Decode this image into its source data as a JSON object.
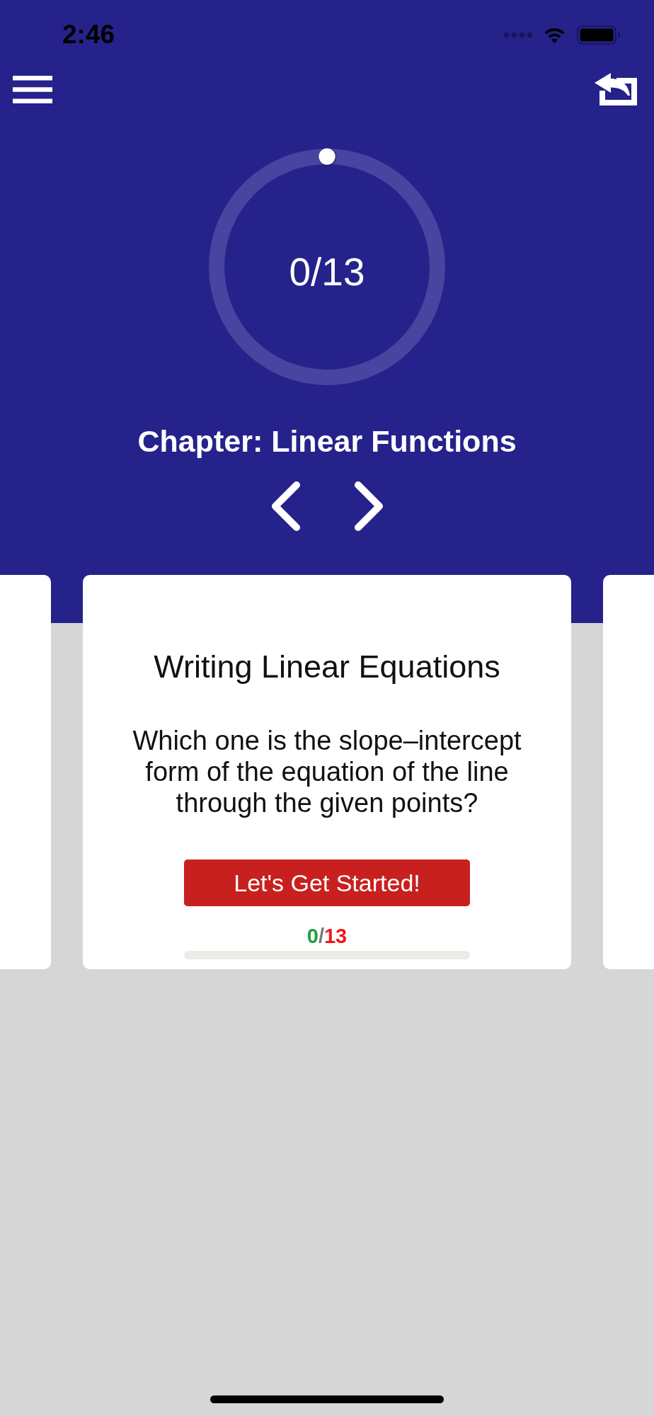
{
  "status_bar": {
    "time": "2:46"
  },
  "progress_ring": {
    "label": "0/13"
  },
  "chapter": {
    "title": "Chapter: Linear Functions"
  },
  "cards": [
    {
      "kind": "peek"
    },
    {
      "kind": "lesson",
      "title": "Writing Linear Equations",
      "question": "Which one is the slope–intercept form of the equation of the line through the given points?",
      "button": "Let's Get Started!",
      "score": {
        "correct": "0",
        "separator": "/",
        "total": "13"
      },
      "progress": {
        "level": 0
      }
    },
    {
      "kind": "peek"
    }
  ]
}
